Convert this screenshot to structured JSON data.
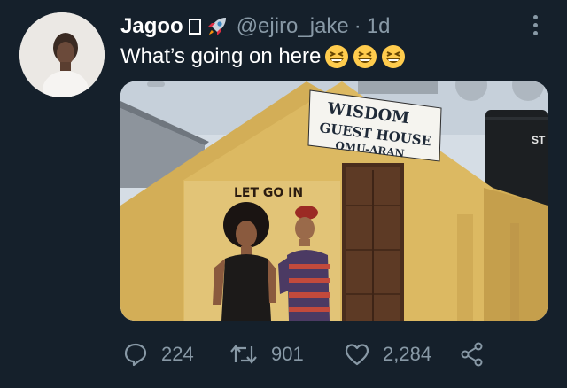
{
  "tweet": {
    "author_name": "Jagoo",
    "handle": "@ejiro_jake",
    "separator": "·",
    "time": "1d",
    "text": "What’s going on here",
    "emojis": [
      "grinning-squinting-face",
      "grinning-squinting-face",
      "grinning-squinting-face"
    ]
  },
  "media": {
    "sign_line1": "WISDOM",
    "sign_line2": "GUEST HOUSE",
    "sign_line3": "OMU-ARAN",
    "mural_text": "LET GO IN",
    "tank_text": "ST"
  },
  "actions": {
    "reply_count": "224",
    "retweet_count": "901",
    "like_count": "2,284"
  },
  "colors": {
    "background": "#15202b",
    "muted": "#8899a6",
    "text": "#ffffff"
  }
}
